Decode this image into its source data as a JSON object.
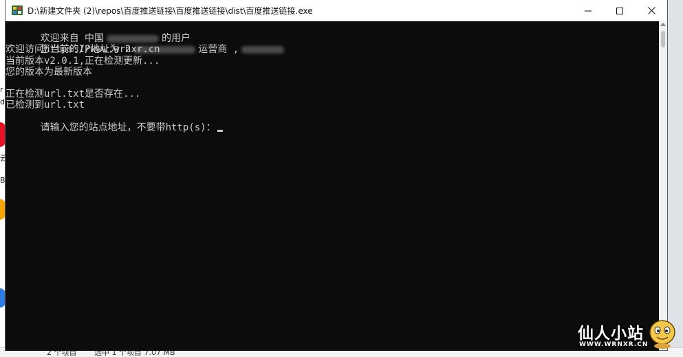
{
  "window": {
    "title": "D:\\新建文件夹 (2)\\repos\\百度推送链接\\百度推送链接\\dist\\百度推送链接.exe"
  },
  "console": {
    "l1_a": "欢迎来自 中国",
    "l1_b": "的用户",
    "l2_a": "您当前的IP地址为 2",
    "l2_b": "运营商 ,",
    "l3": "欢迎访问https://www.wrnxr.cn",
    "l4": "当前版本v2.0.1,正在检测更新...",
    "l5": "您的版本为最新版本",
    "l6": "",
    "l7": "正在检测url.txt是否存在...",
    "l8": "已检测到url.txt",
    "l9": "请输入您的站点地址，不要带http(s)："
  },
  "background": {
    "left_bits": [
      "r",
      "d",
      "云",
      "B"
    ]
  },
  "explorer_status": {
    "count": "2 个项目",
    "selected": "选中 1 个项目  7.07 MB"
  },
  "watermark": {
    "name": "仙人小站",
    "domain": "WWW.WRNXR.CN"
  }
}
